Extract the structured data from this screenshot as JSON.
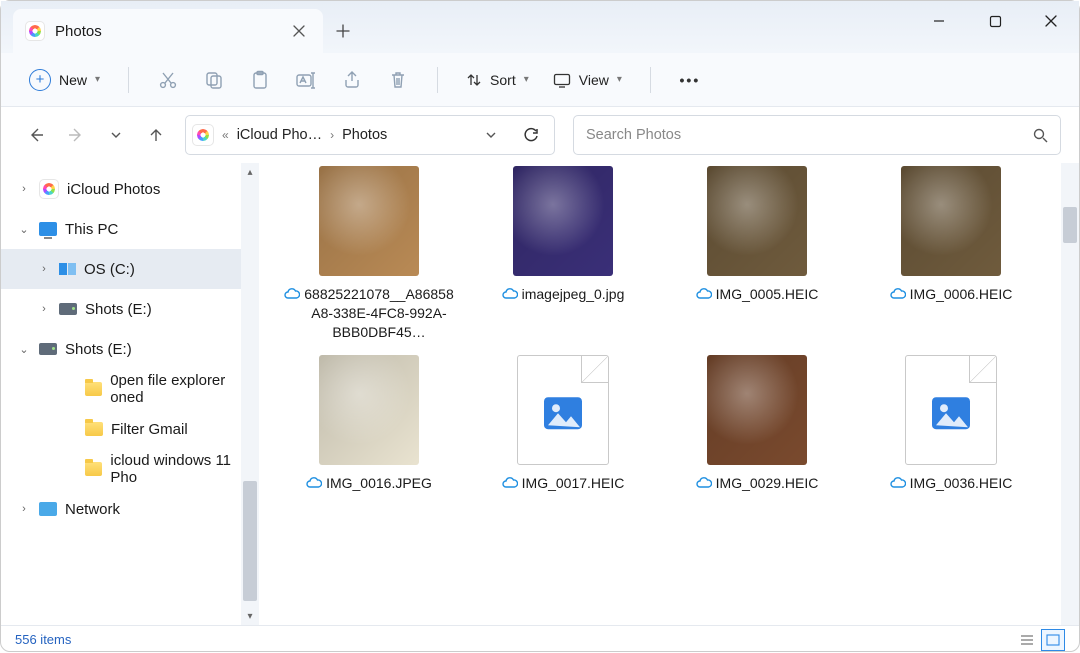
{
  "window": {
    "title": "Photos"
  },
  "toolbar": {
    "new_label": "New",
    "sort_label": "Sort",
    "view_label": "View"
  },
  "breadcrumb": {
    "segments": [
      "iCloud Pho…",
      "Photos"
    ]
  },
  "search": {
    "placeholder": "Search Photos"
  },
  "sidebar": {
    "items": [
      {
        "caret": ">",
        "icon": "photoapp",
        "label": "iCloud Photos",
        "depth": 0
      },
      {
        "caret": "v",
        "icon": "pc",
        "label": "This PC",
        "depth": 0
      },
      {
        "caret": ">",
        "icon": "drive-os",
        "label": "OS (C:)",
        "depth": 1,
        "selected": true
      },
      {
        "caret": ">",
        "icon": "drive",
        "label": "Shots (E:)",
        "depth": 1
      },
      {
        "caret": "v",
        "icon": "drive",
        "label": "Shots (E:)",
        "depth": 0
      },
      {
        "caret": "",
        "icon": "folder",
        "label": "0pen file explorer oned",
        "depth": 2
      },
      {
        "caret": "",
        "icon": "folder",
        "label": "Filter Gmail",
        "depth": 2
      },
      {
        "caret": "",
        "icon": "folder",
        "label": "icloud windows 11 Pho",
        "depth": 2
      },
      {
        "caret": ">",
        "icon": "network",
        "label": "Network",
        "depth": 0
      }
    ]
  },
  "files": [
    {
      "name": "68825221078__A86858A8-338E-4FC8-992A-BBB0DBF45…",
      "kind": "image",
      "color": "#b98a55"
    },
    {
      "name": "imagejpeg_0.jpg",
      "kind": "image",
      "color": "#3a2f78"
    },
    {
      "name": "IMG_0005.HEIC",
      "kind": "image",
      "color": "#6f5b3d"
    },
    {
      "name": "IMG_0006.HEIC",
      "kind": "image",
      "color": "#6f5b3d"
    },
    {
      "name": "IMG_0016.JPEG",
      "kind": "image",
      "color": "#e9e3d0"
    },
    {
      "name": "IMG_0017.HEIC",
      "kind": "doc"
    },
    {
      "name": "IMG_0029.HEIC",
      "kind": "image",
      "color": "#7a4a2e"
    },
    {
      "name": "IMG_0036.HEIC",
      "kind": "doc"
    }
  ],
  "status": {
    "count_label": "556 items"
  }
}
